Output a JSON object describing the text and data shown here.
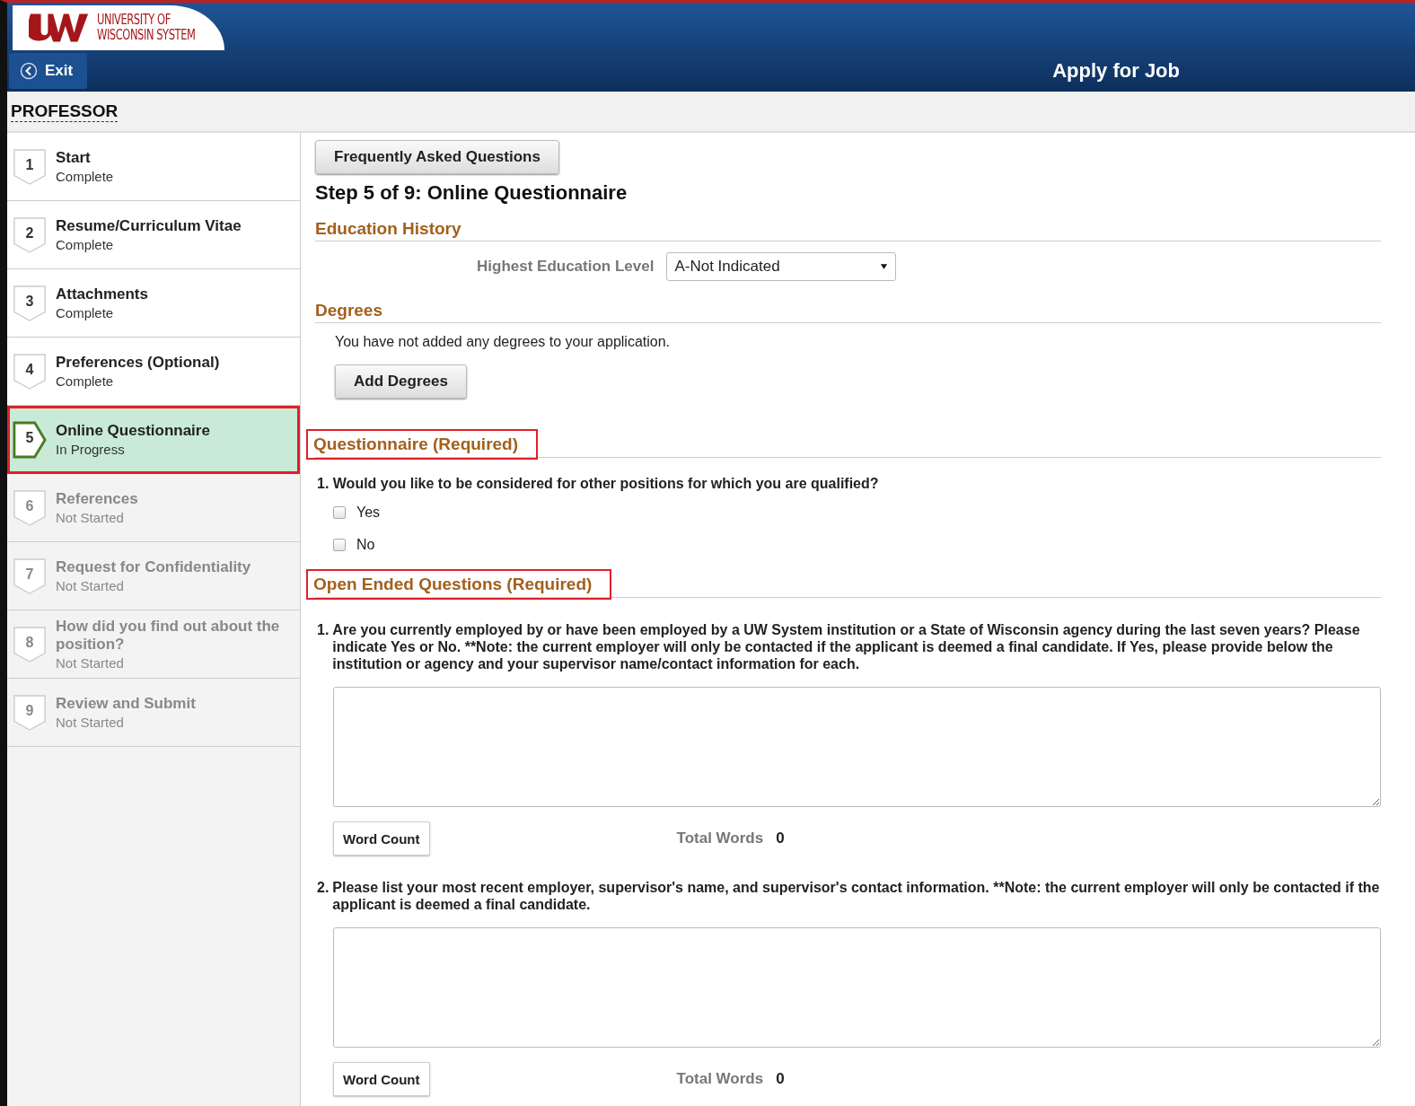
{
  "header": {
    "logo_line_1": "UNIVERSITY OF",
    "logo_line_2": "WISCONSIN SYSTEM",
    "exit_label": "Exit",
    "title": "Apply for Job"
  },
  "job_title": "PROFESSOR",
  "steps": [
    {
      "number": "1",
      "name": "Start",
      "status": "Complete",
      "kind": "done",
      "selected": false,
      "highlighted": false
    },
    {
      "number": "2",
      "name": "Resume/Curriculum Vitae",
      "status": "Complete",
      "kind": "done",
      "selected": false,
      "highlighted": false
    },
    {
      "number": "3",
      "name": "Attachments",
      "status": "Complete",
      "kind": "done",
      "selected": false,
      "highlighted": false
    },
    {
      "number": "4",
      "name": "Preferences (Optional)",
      "status": "Complete",
      "kind": "done",
      "selected": false,
      "highlighted": false
    },
    {
      "number": "5",
      "name": "Online Questionnaire",
      "status": "In Progress",
      "kind": "current",
      "selected": true,
      "highlighted": true
    },
    {
      "number": "6",
      "name": "References",
      "status": "Not Started",
      "kind": "todo",
      "selected": false,
      "highlighted": false
    },
    {
      "number": "7",
      "name": "Request for Confidentiality",
      "status": "Not Started",
      "kind": "todo",
      "selected": false,
      "highlighted": false
    },
    {
      "number": "8",
      "name": "How did you find out about the position?",
      "status": "Not Started",
      "kind": "todo",
      "selected": false,
      "highlighted": false
    },
    {
      "number": "9",
      "name": "Review and Submit",
      "status": "Not Started",
      "kind": "todo",
      "selected": false,
      "highlighted": false
    }
  ],
  "faq_button": "Frequently Asked Questions",
  "step_heading": "Step 5 of 9: Online Questionnaire",
  "education": {
    "heading": "Education History",
    "field_label": "Highest Education Level",
    "field_value": "A-Not Indicated"
  },
  "degrees": {
    "heading": "Degrees",
    "message": "You have not added any degrees to your application.",
    "button": "Add Degrees"
  },
  "questionnaire": {
    "heading": "Questionnaire (Required)",
    "highlighted": true,
    "question": "1. Would you like to be considered for other positions for which you are qualified?",
    "options": [
      {
        "label": "Yes",
        "checked": false
      },
      {
        "label": "No",
        "checked": false
      }
    ]
  },
  "open_ended": {
    "heading": "Open Ended Questions (Required)",
    "highlighted": true,
    "questions": [
      {
        "number": "1.",
        "text": "Are you currently employed by or have been employed by a UW System institution or a State of Wisconsin agency during the last seven years? Please indicate Yes or No. **Note: the current employer will only be contacted if the applicant is deemed a final candidate. If Yes, please provide below the institution or agency and your supervisor name/contact information for each.",
        "button": "Word Count",
        "total_label": "Total Words",
        "total": "0"
      },
      {
        "number": "2.",
        "text": "Please list your most recent employer, supervisor's name, and supervisor's contact information. **Note: the current employer will only be contacted if the applicant is deemed a final candidate.",
        "button": "Word Count",
        "total_label": "Total Words",
        "total": "0"
      }
    ]
  }
}
